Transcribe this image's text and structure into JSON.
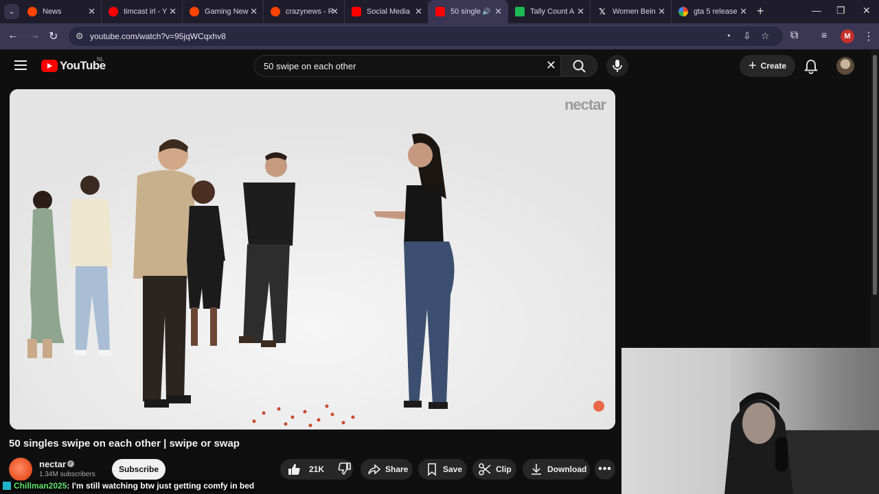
{
  "browser": {
    "tabs": [
      {
        "title": "News",
        "favicon": "reddit-icon",
        "color": "#ff4500"
      },
      {
        "title": "timcast irl - Y",
        "favicon": "youtube-icon",
        "color": "#ff0000"
      },
      {
        "title": "Gaming New",
        "favicon": "reddit-icon",
        "color": "#ff4500"
      },
      {
        "title": "crazynews - R",
        "favicon": "reddit-icon",
        "color": "#ff4500"
      },
      {
        "title": "Social Media",
        "favicon": "youtube-icon",
        "color": "#ff0000"
      },
      {
        "title": "50 single",
        "favicon": "youtube-icon",
        "color": "#ff0000"
      },
      {
        "title": "Tally Count A",
        "favicon": "tally-icon",
        "color": "#1db954"
      },
      {
        "title": "Women Bein",
        "favicon": "x-icon",
        "color": "#000000"
      },
      {
        "title": "gta 5 release",
        "favicon": "google-icon",
        "color": "#4285f4"
      }
    ],
    "url": "youtube.com/watch?v=95jqWCqxhv8",
    "profile_initial": "M"
  },
  "youtube": {
    "logo_text": "YouTube",
    "country_code": "NL",
    "search_query": "50 swipe on each other",
    "create_label": "Create"
  },
  "video": {
    "watermark": "nectar",
    "title": "50 singles swipe on each other | swipe or swap",
    "channel": "nectar",
    "subscribers": "1.34M subscribers",
    "subscribe_label": "Subscribe",
    "likes": "21K",
    "share_label": "Share",
    "save_label": "Save",
    "clip_label": "Clip",
    "download_label": "Download"
  },
  "chat_overlay": {
    "user": "Chillman2025",
    "message": ": I'm still watching btw just getting comfy in bed"
  }
}
